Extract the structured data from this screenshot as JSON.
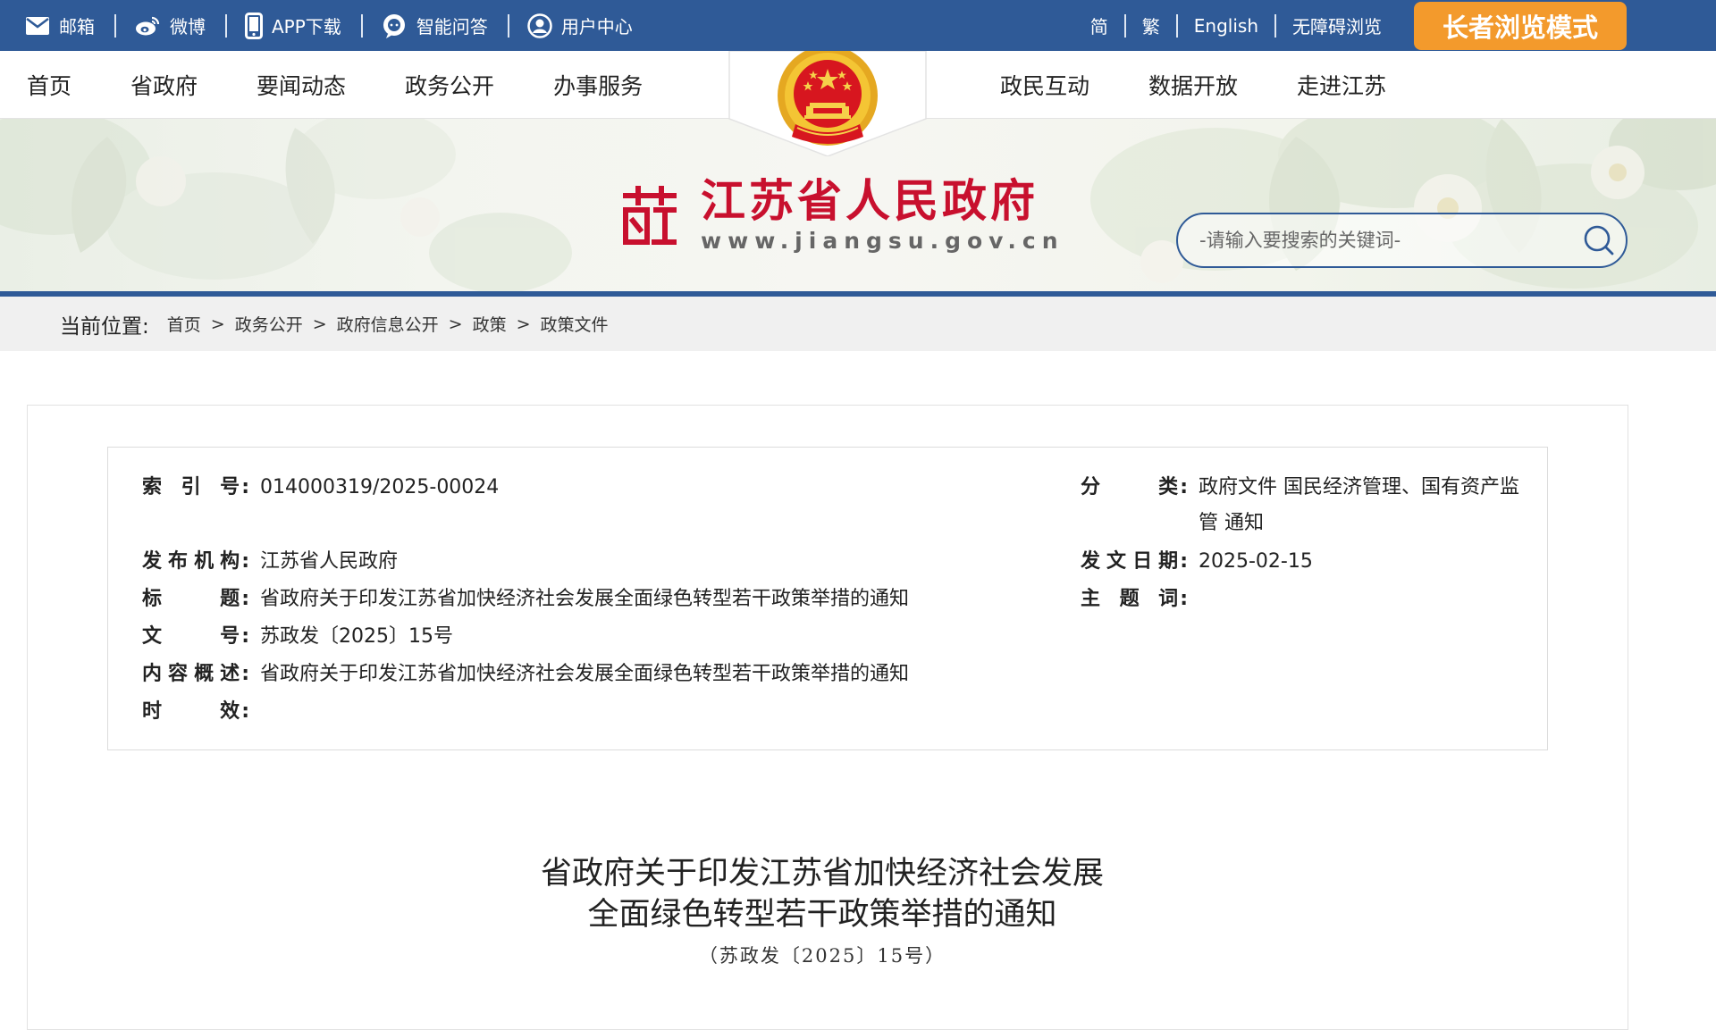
{
  "topbar": {
    "links": [
      {
        "label": "邮箱",
        "icon": "mail-icon"
      },
      {
        "label": "微博",
        "icon": "weibo-icon"
      },
      {
        "label": "APP下载",
        "icon": "phone-icon"
      },
      {
        "label": "智能问答",
        "icon": "chat-icon"
      },
      {
        "label": "用户中心",
        "icon": "user-icon"
      }
    ],
    "lang": [
      "简",
      "繁",
      "English",
      "无障碍浏览"
    ],
    "elder_mode": "长者浏览模式"
  },
  "nav": {
    "left": [
      "首页",
      "省政府",
      "要闻动态",
      "政务公开",
      "办事服务"
    ],
    "right": [
      "政民互动",
      "数据开放",
      "走进江苏"
    ]
  },
  "site": {
    "title": "江苏省人民政府",
    "domain": "www.jiangsu.gov.cn"
  },
  "search": {
    "placeholder": "-请输入要搜索的关键词-"
  },
  "breadcrumb": {
    "label": "当前位置:",
    "items": [
      "首页",
      "政务公开",
      "政府信息公开",
      "政策",
      "政策文件"
    ]
  },
  "meta": {
    "index_no": {
      "label": "索引号",
      "value": "014000319/2025-00024"
    },
    "publisher": {
      "label": "发布机构",
      "value": "江苏省人民政府"
    },
    "title": {
      "label": "标题",
      "value": "省政府关于印发江苏省加快经济社会发展全面绿色转型若干政策举措的通知"
    },
    "doc_no": {
      "label": "文号",
      "value": "苏政发〔2025〕15号"
    },
    "summary": {
      "label": "内容概述",
      "value": "省政府关于印发江苏省加快经济社会发展全面绿色转型若干政策举措的通知"
    },
    "validity": {
      "label": "时效",
      "value": ""
    },
    "category": {
      "label": "分类",
      "value_line1": "政府文件 国民经济管理、国有资产监",
      "value_line2": "管 通知"
    },
    "date": {
      "label": "发文日期",
      "value": "2025-02-15"
    },
    "keywords": {
      "label": "主题词",
      "value": ""
    }
  },
  "document": {
    "title_line1": "省政府关于印发江苏省加快经济社会发展",
    "title_line2": "全面绿色转型若干政策举措的通知",
    "number": "（苏政发〔2025〕15号）"
  },
  "colors": {
    "primary_blue": "#2f5a97",
    "elder_orange": "#f39a2c",
    "title_red": "#c8102e"
  }
}
